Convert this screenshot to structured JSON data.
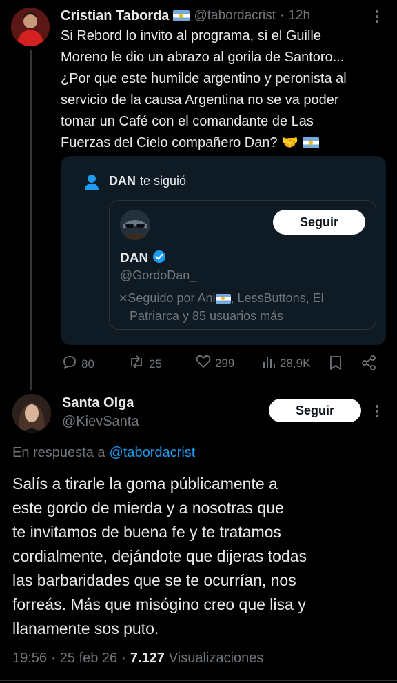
{
  "tweet1": {
    "author_name": "Cristian Taborda",
    "author_flag": "argentina-flag-icon",
    "handle": "@tabordacrist",
    "separator": "·",
    "time": "12h",
    "text_lines": [
      "Si Rebord lo invito al programa, si el Guille",
      "Moreno le dio un abrazo al gorila de Santoro...",
      "¿Por que este humilde argentino y peronista al",
      "servicio de la causa Argentina no se va poder",
      "tomar un Café con el comandante de Las",
      "Fuerzas del Cielo compañero Dan? 🤝"
    ],
    "card": {
      "follow_user": "DAN",
      "follow_text": "te siguió",
      "profile_name": "DAN",
      "profile_handle": "@GordoDan_",
      "follow_button": "Seguir",
      "followed_by_line1": "Seguido por Ani",
      "followed_by_line1b": ", LessButtons, El",
      "followed_by_line2": "Patriarca y 85 usuarios más"
    },
    "actions": {
      "replies": "80",
      "reposts": "25",
      "likes": "299",
      "views": "28,9K"
    }
  },
  "tweet2": {
    "author_name": "Santa Olga",
    "handle": "@KievSanta",
    "follow_button": "Seguir",
    "reply_prefix": "En respuesta a",
    "reply_to": "@tabordacrist",
    "text_lines": [
      "Salís a tirarle la goma públicamente a",
      "este gordo de mierda y a nosotras que",
      "te invitamos de buena fe y te tratamos",
      "cordialmente, dejándote que dijeras todas",
      "las barbaridades que se te ocurrían, nos",
      "forreás. Más que misógino creo que lisa y",
      "llanamente sos puto."
    ],
    "time": "19:56",
    "date": "25 feb 26",
    "views_count": "7.127",
    "views_label": "Visualizaciones"
  },
  "colors": {
    "background": "#000000",
    "text": "#e7e9ea",
    "muted": "#71767b",
    "link": "#1d9bf0",
    "card_bg": "#0e1a24",
    "verified": "#1d9bf0"
  }
}
